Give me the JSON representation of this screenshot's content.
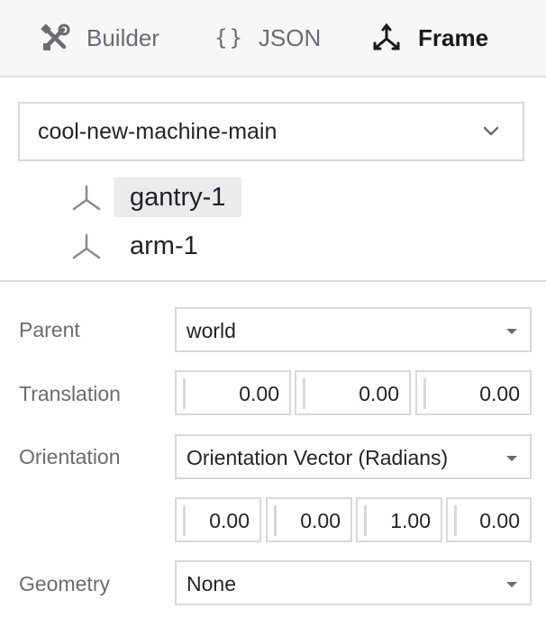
{
  "tabs": [
    {
      "label": "Builder",
      "icon": "wrench-screwdriver-icon"
    },
    {
      "label": "JSON",
      "icon": "braces-icon",
      "glyph": "{}"
    },
    {
      "label": "Frame",
      "icon": "frame-axes-icon",
      "active": true
    }
  ],
  "machine_select": {
    "value": "cool-new-machine-main"
  },
  "frame_tree": [
    {
      "label": "gantry-1",
      "selected": true
    },
    {
      "label": "arm-1",
      "selected": false
    }
  ],
  "form": {
    "parent": {
      "label": "Parent",
      "value": "world"
    },
    "translation": {
      "label": "Translation",
      "values": [
        "0.00",
        "0.00",
        "0.00"
      ]
    },
    "orientation": {
      "label": "Orientation",
      "type": "Orientation Vector (Radians)",
      "values": [
        "0.00",
        "0.00",
        "1.00",
        "0.00"
      ]
    },
    "geometry": {
      "label": "Geometry",
      "value": "None"
    }
  },
  "colors": {
    "tab_bar_bg": "#f7f7f8",
    "border": "#d8d8dc",
    "muted_text": "#6b6b73",
    "selected_bg": "#ebebed"
  }
}
